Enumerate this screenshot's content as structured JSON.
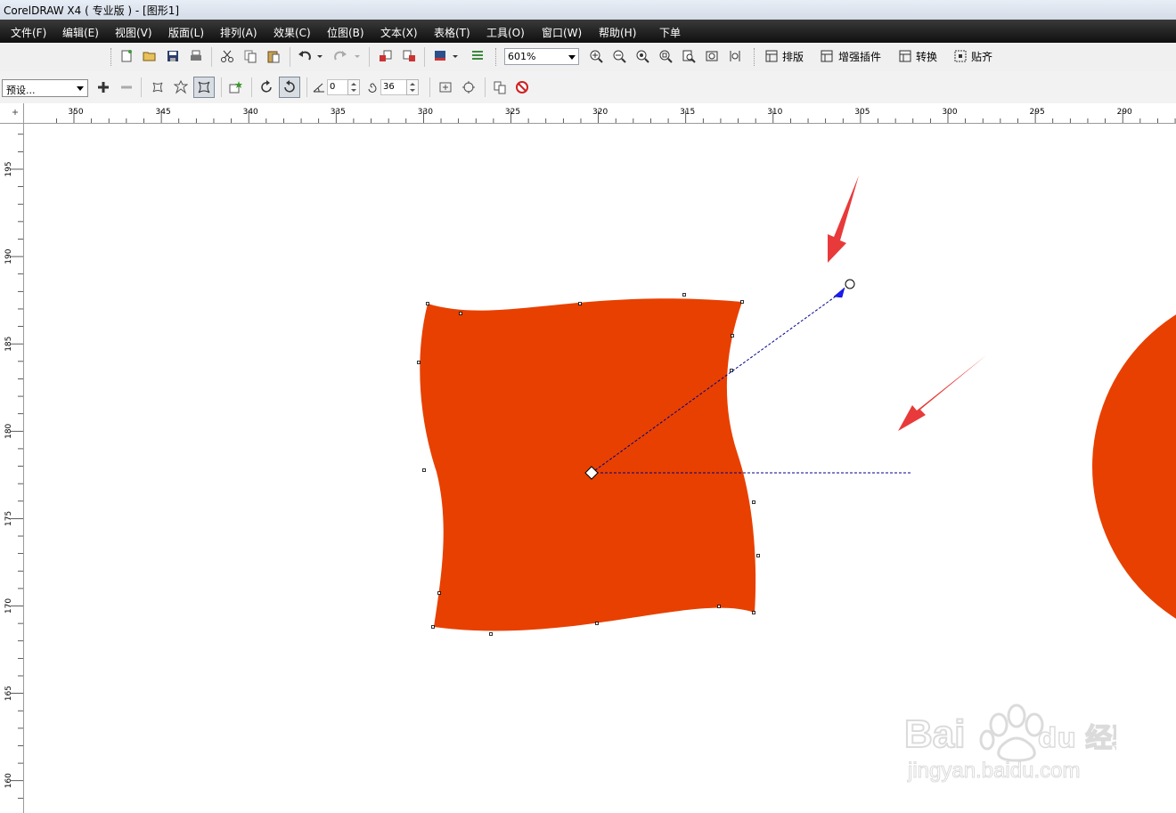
{
  "window": {
    "title": "CorelDRAW X4 ( 专业版 ) - [图形1]"
  },
  "menu": [
    {
      "label": "文件(F)"
    },
    {
      "label": "编辑(E)"
    },
    {
      "label": "视图(V)"
    },
    {
      "label": "版面(L)"
    },
    {
      "label": "排列(A)"
    },
    {
      "label": "效果(C)"
    },
    {
      "label": "位图(B)"
    },
    {
      "label": "文本(X)"
    },
    {
      "label": "表格(T)"
    },
    {
      "label": "工具(O)"
    },
    {
      "label": "窗口(W)"
    },
    {
      "label": "帮助(H)"
    },
    {
      "label": "下单"
    }
  ],
  "standard_toolbar": {
    "zoom_value": "601%",
    "plugin_buttons": [
      {
        "label": "排版"
      },
      {
        "label": "增强插件"
      },
      {
        "label": "转换"
      },
      {
        "label": "贴齐"
      }
    ]
  },
  "property_bar": {
    "preset": "预设...",
    "angle": "0",
    "points": "36"
  },
  "rulers": {
    "horizontal_ticks": [
      "350",
      "345",
      "340",
      "335",
      "330",
      "325",
      "320",
      "315",
      "310",
      "305",
      "300",
      "295",
      "290"
    ],
    "vertical_ticks": [
      "195",
      "190",
      "185",
      "180",
      "175",
      "170",
      "165",
      "160"
    ]
  },
  "watermark": {
    "logo": "Bai du 经验",
    "url": "jingyan.baidu.com"
  },
  "colors": {
    "shape_fill": "#e84000",
    "arrow": "#e83a3a",
    "handle_line": "#00008b",
    "menubar": "#1a1a1a"
  },
  "icons": [
    "new-icon",
    "open-icon",
    "save-icon",
    "print-icon",
    "cut-icon",
    "copy-icon",
    "paste-icon",
    "undo-icon",
    "redo-icon",
    "import-icon",
    "export-icon",
    "app-launcher-icon",
    "welcome-icon",
    "zoom-in-icon",
    "zoom-out-icon",
    "zoom-selected-icon",
    "zoom-all-icon",
    "zoom-page-icon",
    "zoom-width-icon",
    "zoom-height-icon"
  ]
}
